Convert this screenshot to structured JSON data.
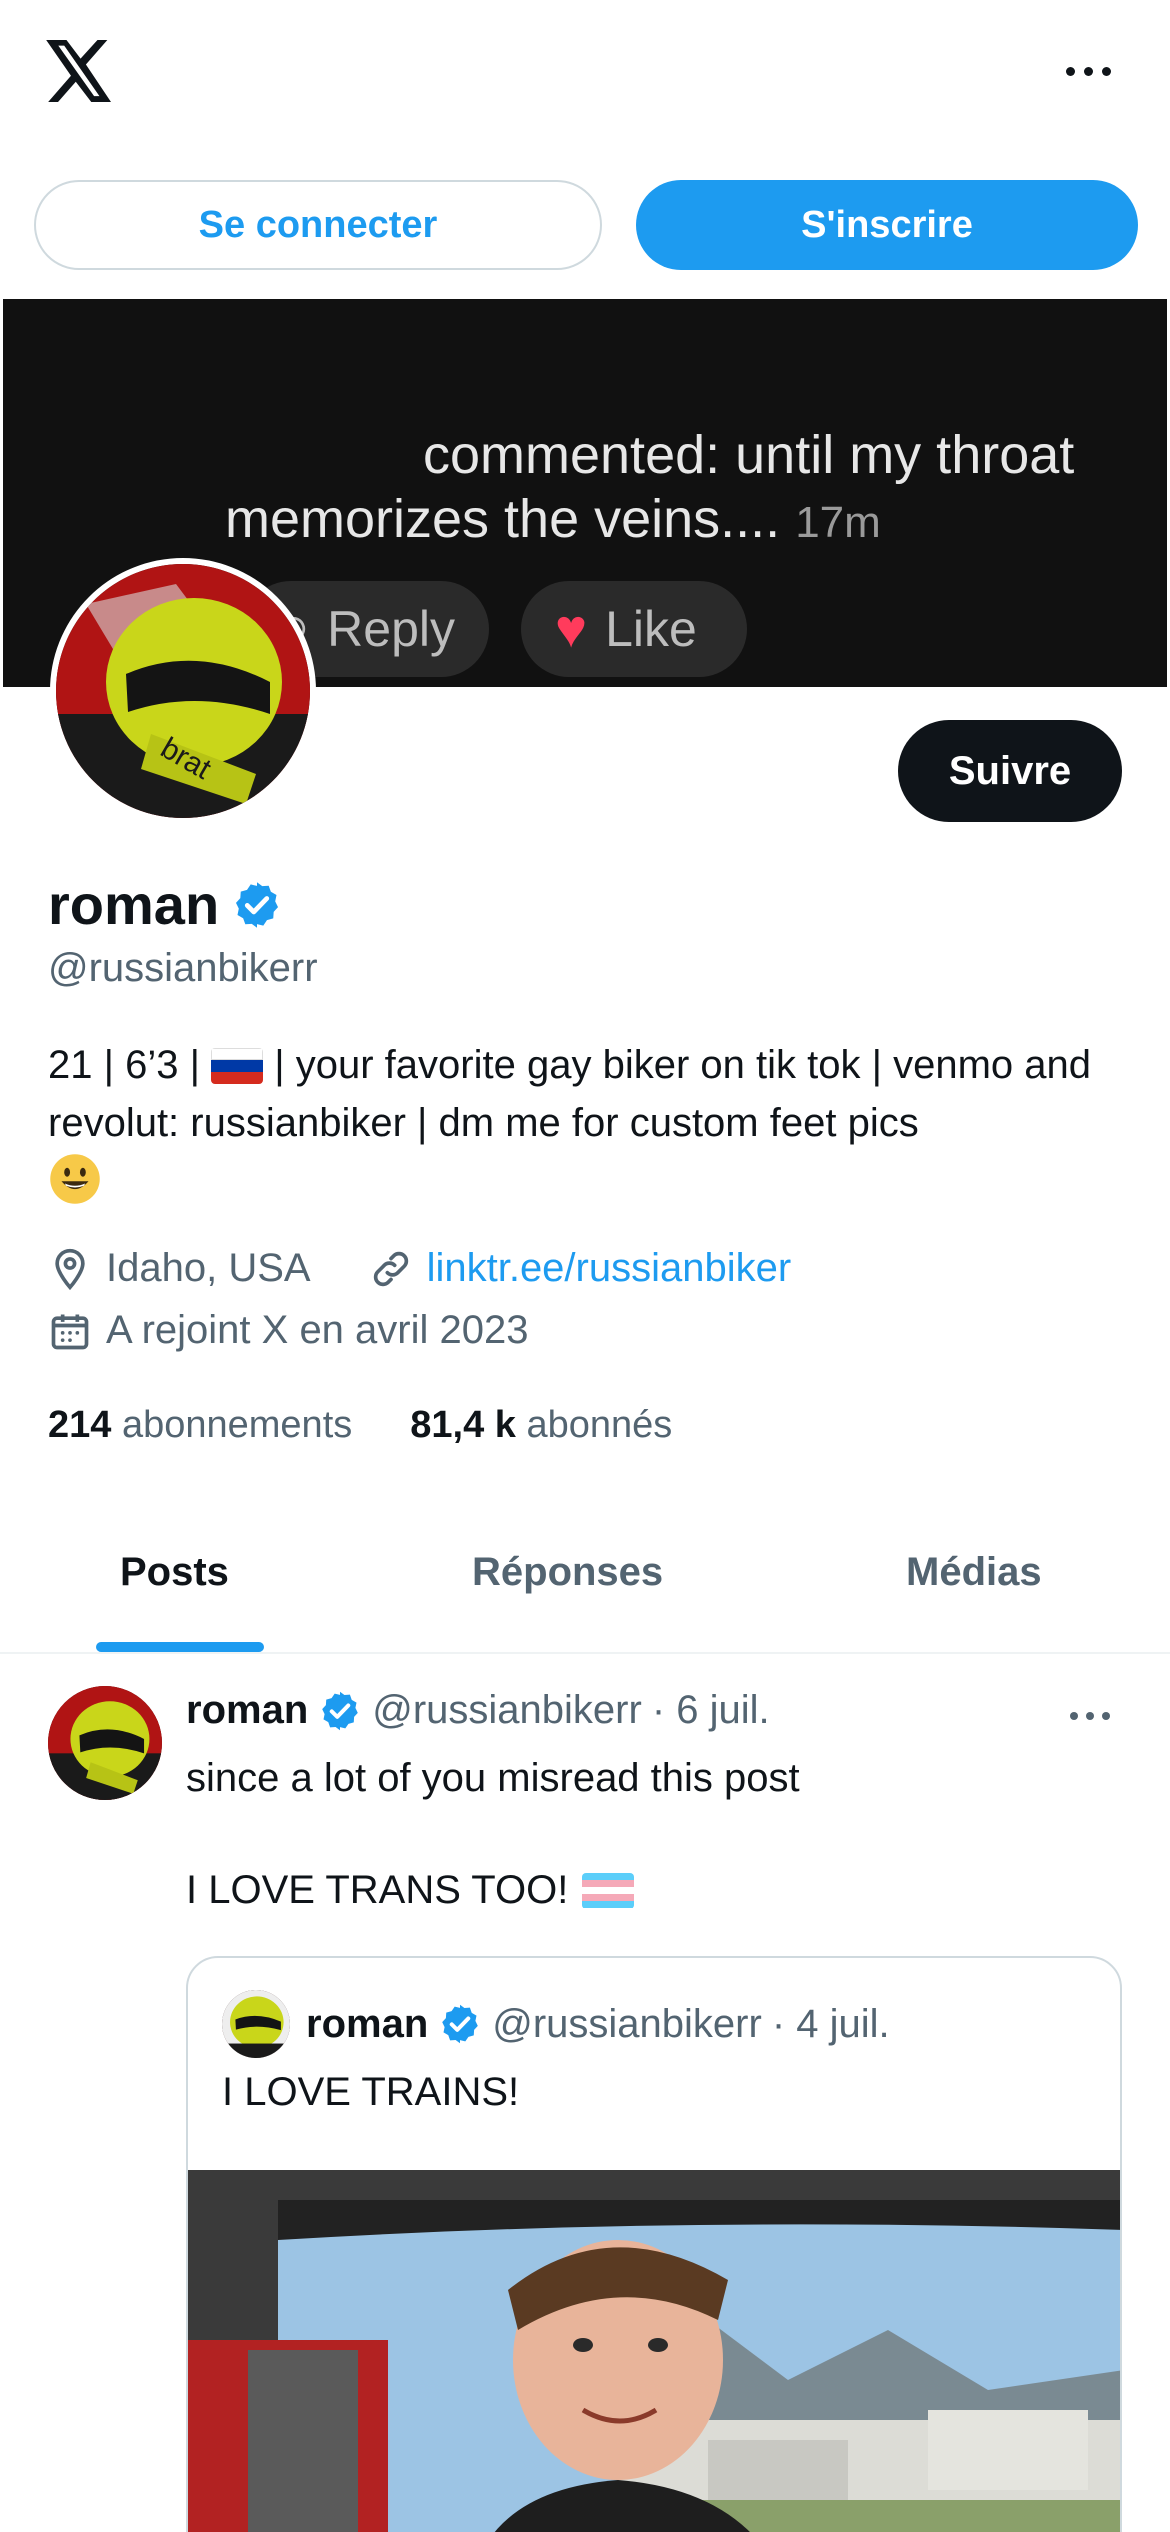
{
  "top": {
    "logo": "x-logo-icon",
    "more": "more-icon"
  },
  "auth": {
    "login_label": "Se connecter",
    "signup_label": "S'inscrire"
  },
  "banner": {
    "line1": "commented: until my throat",
    "line2": "memorizes the veins....",
    "time": "17m",
    "reply_label": "Reply",
    "like_label": "Like"
  },
  "profile": {
    "follow_label": "Suivre",
    "name": "roman",
    "handle": "@russianbikerr",
    "bio_part1": "21 | 6’3 |",
    "bio_part2": "| your favorite gay biker on tik tok | venmo and revolut: russianbiker | dm me for custom feet pics",
    "location": "Idaho, USA",
    "link": "linktr.ee/russianbiker",
    "joined": "A rejoint X en avril 2023",
    "following_count": "214",
    "following_label": "abonnements",
    "followers_count": "81,4 k",
    "followers_label": "abonnés"
  },
  "tabs": [
    {
      "label": "Posts",
      "selected": true
    },
    {
      "label": "Réponses",
      "selected": false
    },
    {
      "label": "Médias",
      "selected": false
    }
  ],
  "post": {
    "name": "roman",
    "handle": "@russianbikerr",
    "date": "· 6 juil.",
    "text1": "since a lot of you misread this post",
    "text2": "I LOVE TRANS TOO!",
    "quote": {
      "name": "roman",
      "handle": "@russianbikerr",
      "date": "· 4 juil.",
      "text": "I LOVE TRAINS!"
    }
  },
  "colors": {
    "accent": "#1d9bf0",
    "text": "#0f1419",
    "secondary": "#536471",
    "border": "#cfd9de"
  }
}
